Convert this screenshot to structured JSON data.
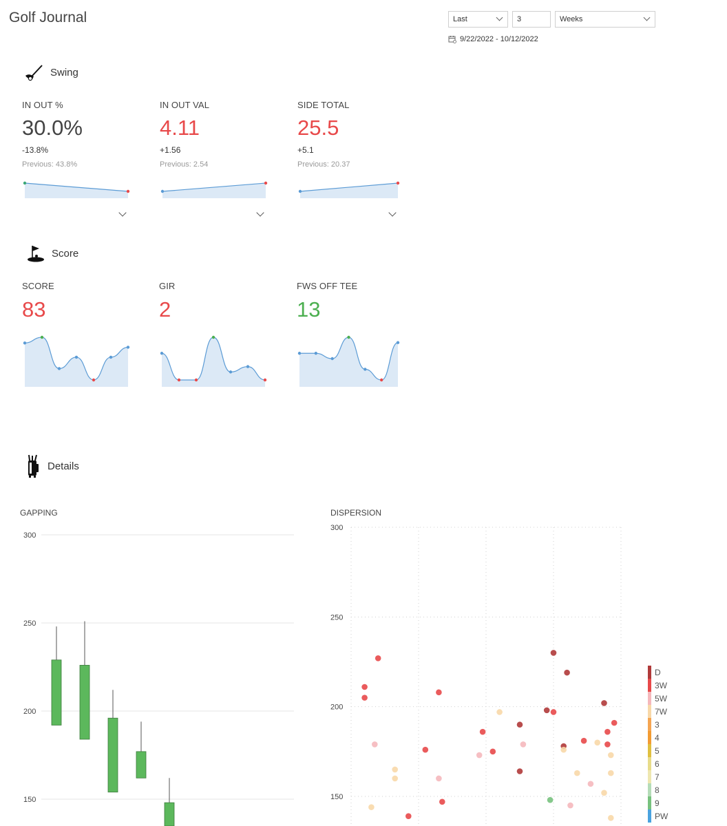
{
  "app": {
    "title": "Golf Journal"
  },
  "filter": {
    "period": "Last",
    "count": "3",
    "unit": "Weeks",
    "date_range": "9/22/2022 - 10/12/2022",
    "calendar_icon": "calendar-icon"
  },
  "sections": {
    "swing": {
      "label": "Swing",
      "icon": "golf-club-icon"
    },
    "score": {
      "label": "Score",
      "icon": "golf-flag-icon"
    },
    "details": {
      "label": "Details",
      "icon": "golf-bag-icon"
    }
  },
  "swing_kpis": [
    {
      "label": "IN OUT %",
      "value": "30.0%",
      "delta": "-13.8%",
      "previous": "Previous: 43.8%",
      "color": "#444444",
      "trend": [
        43.8,
        30.0
      ]
    },
    {
      "label": "IN OUT VAL",
      "value": "4.11",
      "delta": "+1.56",
      "previous": "Previous: 2.54",
      "color": "#e8494a",
      "trend": [
        2.54,
        4.11
      ]
    },
    {
      "label": "SIDE TOTAL",
      "value": "25.5",
      "delta": "+5.1",
      "previous": "Previous: 20.37",
      "color": "#e8494a",
      "trend": [
        20.37,
        25.5
      ]
    }
  ],
  "score_kpis": [
    {
      "label": "SCORE",
      "value": "83",
      "color": "#e8494a",
      "trend": [
        86,
        90,
        68,
        76,
        60,
        76,
        83
      ]
    },
    {
      "label": "GIR",
      "value": "2",
      "color": "#e8494a",
      "trend": [
        5,
        0,
        0,
        8,
        1.5,
        2.5,
        0
      ]
    },
    {
      "label": "FWS OFF TEE",
      "value": "13",
      "color": "#4caf50",
      "trend": [
        11,
        11,
        10,
        14,
        8,
        6,
        13
      ]
    }
  ],
  "chart_data": [
    {
      "type": "candlestick",
      "title": "GAPPING",
      "ylim": [
        133,
        300
      ],
      "yticks": [
        300,
        250,
        200,
        150
      ],
      "grid": true,
      "series": [
        {
          "box_top": 229,
          "box_bottom": 192,
          "whisker_top": 248,
          "whisker_bottom": 192
        },
        {
          "box_top": 226,
          "box_bottom": 184,
          "whisker_top": 251,
          "whisker_bottom": 184
        },
        {
          "box_top": 196,
          "box_bottom": 154,
          "whisker_top": 212,
          "whisker_bottom": 154
        },
        {
          "box_top": 177,
          "box_bottom": 162,
          "whisker_top": 194,
          "whisker_bottom": 162
        },
        {
          "box_top": 148,
          "box_bottom": 133,
          "whisker_top": 162,
          "whisker_bottom": 133
        }
      ],
      "bar_color": "#5cb85c"
    },
    {
      "type": "scatter",
      "title": "DISPERSION",
      "ylim": [
        134,
        300
      ],
      "yticks": [
        300,
        250,
        200,
        150
      ],
      "xlim": [
        -40,
        40
      ],
      "grid": true,
      "legend": [
        "D",
        "3W",
        "5W",
        "7W",
        "3",
        "4",
        "5",
        "6",
        "7",
        "8",
        "9",
        "PW"
      ],
      "legend_colors": [
        "#b03a3a",
        "#e8494a",
        "#f5b8bc",
        "#f8d8a8",
        "#f5a552",
        "#f39c33",
        "#e0c040",
        "#e8dc8a",
        "#eee7b0",
        "#b5dcb8",
        "#78c27e",
        "#4aa3df"
      ],
      "points": [
        {
          "x": -36,
          "y": 211,
          "club": "3W"
        },
        {
          "x": -36,
          "y": 205,
          "club": "3W"
        },
        {
          "x": -33,
          "y": 179,
          "club": "5W"
        },
        {
          "x": -32,
          "y": 227,
          "club": "3W"
        },
        {
          "x": -34,
          "y": 144,
          "club": "7W"
        },
        {
          "x": -27,
          "y": 160,
          "club": "7W"
        },
        {
          "x": -27,
          "y": 165,
          "club": "7W"
        },
        {
          "x": -23,
          "y": 139,
          "club": "3W"
        },
        {
          "x": -18,
          "y": 176,
          "club": "3W"
        },
        {
          "x": -14,
          "y": 208,
          "club": "3W"
        },
        {
          "x": -14,
          "y": 160,
          "club": "5W"
        },
        {
          "x": -13,
          "y": 147,
          "club": "3W"
        },
        {
          "x": -2,
          "y": 173,
          "club": "5W"
        },
        {
          "x": -1,
          "y": 186,
          "club": "3W"
        },
        {
          "x": 2,
          "y": 175,
          "club": "3W"
        },
        {
          "x": 4,
          "y": 197,
          "club": "7W"
        },
        {
          "x": 10,
          "y": 190,
          "club": "D"
        },
        {
          "x": 10,
          "y": 164,
          "club": "D"
        },
        {
          "x": 11,
          "y": 179,
          "club": "5W"
        },
        {
          "x": 18,
          "y": 198,
          "club": "D"
        },
        {
          "x": 19,
          "y": 148,
          "club": "9"
        },
        {
          "x": 20,
          "y": 230,
          "club": "D"
        },
        {
          "x": 20,
          "y": 197,
          "club": "3W"
        },
        {
          "x": 23,
          "y": 178,
          "club": "D"
        },
        {
          "x": 23,
          "y": 176,
          "club": "7W"
        },
        {
          "x": 24,
          "y": 219,
          "club": "D"
        },
        {
          "x": 25,
          "y": 145,
          "club": "5W"
        },
        {
          "x": 27,
          "y": 163,
          "club": "7W"
        },
        {
          "x": 29,
          "y": 181,
          "club": "3W"
        },
        {
          "x": 31,
          "y": 157,
          "club": "5W"
        },
        {
          "x": 33,
          "y": 180,
          "club": "7W"
        },
        {
          "x": 35,
          "y": 202,
          "club": "D"
        },
        {
          "x": 35,
          "y": 152,
          "club": "7W"
        },
        {
          "x": 36,
          "y": 186,
          "club": "3W"
        },
        {
          "x": 36,
          "y": 179,
          "club": "3W"
        },
        {
          "x": 37,
          "y": 173,
          "club": "7W"
        },
        {
          "x": 37,
          "y": 163,
          "club": "7W"
        },
        {
          "x": 37,
          "y": 138,
          "club": "7W"
        },
        {
          "x": 38,
          "y": 191,
          "club": "3W"
        }
      ]
    }
  ]
}
